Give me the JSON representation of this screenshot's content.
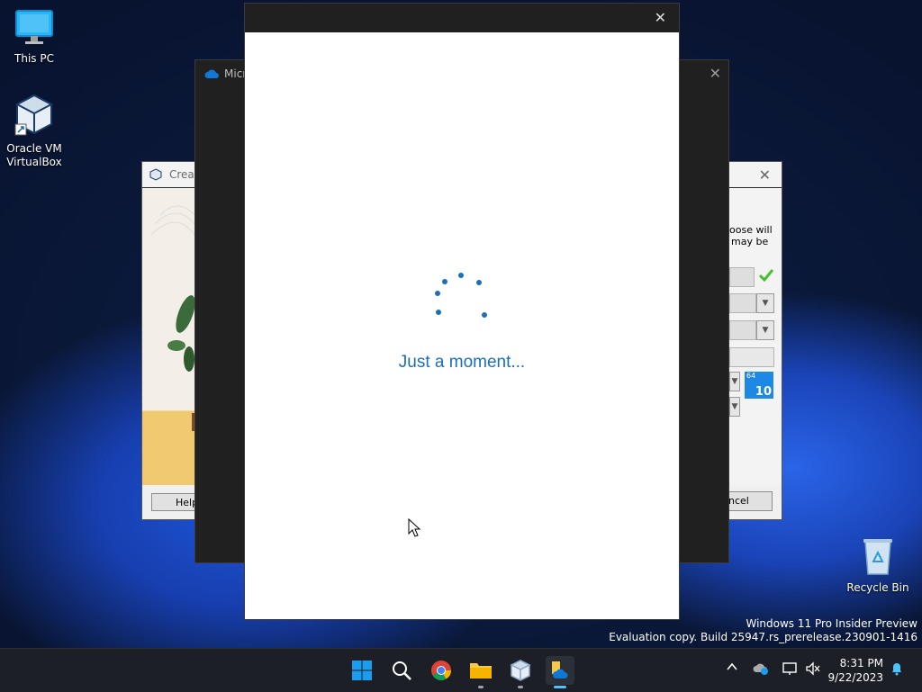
{
  "desktop": {
    "icons": [
      {
        "label": "This PC"
      },
      {
        "label": "Oracle VM\nVirtualBox"
      },
      {
        "label": "Recycle Bin"
      }
    ],
    "watermark": {
      "line1": "Windows 11 Pro Insider Preview",
      "line2": "Evaluation copy. Build 25947.rs_prerelease.230901-1416"
    }
  },
  "vbox_dialog": {
    "title": "Creat",
    "right_text_1": "oose will",
    "right_text_2": "may be",
    "help_label": "Help",
    "cancel_label": "ncel",
    "os_badge": "10",
    "os_badge_small": "64"
  },
  "mid_window": {
    "title": "Micro"
  },
  "front_window": {
    "loading_text": "Just a moment..."
  },
  "taskbar": {
    "apps": [
      "start",
      "search",
      "chrome",
      "file-explorer",
      "virtualbox",
      "onedrive-setup"
    ],
    "clock": {
      "time": "8:31 PM",
      "date": "9/22/2023"
    }
  },
  "colors": {
    "accent": "#1a6fb8",
    "spinner": "#1a6fb8",
    "taskbar": "#1c1f26"
  }
}
